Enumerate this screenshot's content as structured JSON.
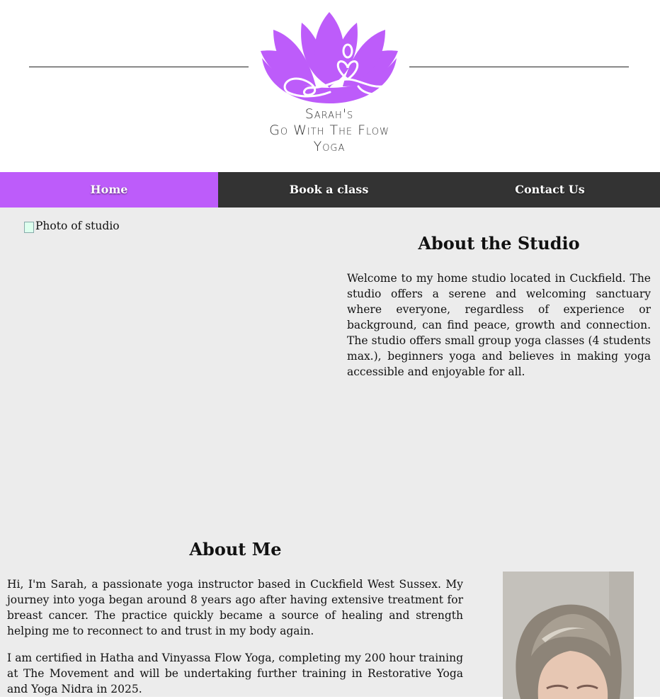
{
  "header": {
    "logo_line1": "Sarah's",
    "logo_line2": "Go With The Flow",
    "logo_line3": "Yoga",
    "brand_color": "#bd5cfa"
  },
  "nav": {
    "items": [
      {
        "label": "Home",
        "active": true
      },
      {
        "label": "Book a class",
        "active": false
      },
      {
        "label": "Contact Us",
        "active": false
      }
    ]
  },
  "studio": {
    "photo_alt": "Photo of studio",
    "title": "About the Studio",
    "text": "Welcome to my home studio located in Cuckfield. The studio offers a serene and welcoming sanctuary where everyone, regardless of experience or background, can find peace, growth and connection. The studio offers small group yoga classes (4 students max.), beginners yoga and believes in making yoga accessible and enjoyable for all."
  },
  "about_me": {
    "title": "About Me",
    "paragraph1": "Hi, I'm Sarah, a passionate yoga instructor based in Cuckfield West Sussex. My journey into yoga began around 8 years ago after having extensive treatment for breast cancer. The practice quickly became a source of healing and strength helping me to reconnect to and trust in my body again.",
    "paragraph2": "I am certified in Hatha and Vinyassa Flow Yoga, completing my 200 hour training at The Movement and will be undertaking further training in Restorative Yoga and Yoga Nidra in 2025."
  }
}
